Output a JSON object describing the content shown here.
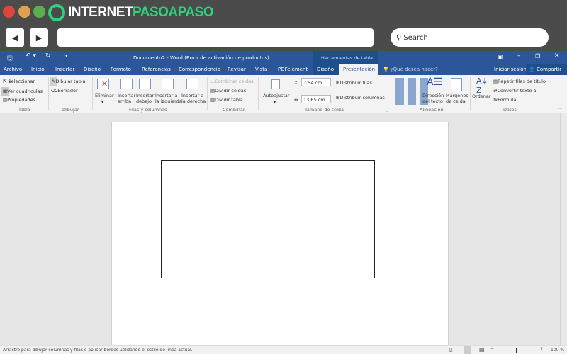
{
  "browser": {
    "brand_white": "INTERNET",
    "brand_green": "PASOAPASO",
    "search_placeholder": "Search",
    "brand_color": "#2fd17a"
  },
  "word": {
    "title": "Documento2 - Word (Error de activación de productos)",
    "context_tab": "Herramientas de tabla",
    "tabs": [
      "Archivo",
      "Inicio",
      "Insertar",
      "Diseño",
      "Formato",
      "Referencias",
      "Correspondencia",
      "Revisar",
      "Vista",
      "PDFelement",
      "Diseño",
      "Presentación"
    ],
    "tell_me": "¿Qué desea hacer?",
    "sign_in": "Iniciar sesión",
    "share": "Compartir"
  },
  "ribbon": {
    "tabla": {
      "items": [
        "Seleccionar",
        "Ver cuadrículas",
        "Propiedades"
      ],
      "group": "Tabla"
    },
    "dibujar": {
      "items": [
        "Dibujar tabla",
        "Borrador"
      ],
      "group": "Dibujar"
    },
    "filas": {
      "eliminar": "Eliminar",
      "ins_arriba": [
        "Insertar",
        "arriba"
      ],
      "ins_debajo": [
        "Insertar",
        "debajo"
      ],
      "ins_izq": [
        "Insertar a",
        "la izquierda"
      ],
      "ins_der": [
        "Insertar a",
        "la derecha"
      ],
      "group": "Filas y columnas"
    },
    "combinar": {
      "items": [
        "Combinar celdas",
        "Dividir celdas",
        "Dividir tabla"
      ],
      "group": "Combinar"
    },
    "tamano": {
      "autoajustar": "Autoajustar",
      "height": "7,54 cm",
      "width": "13,65 cm",
      "dist_filas": "Distribuir filas",
      "dist_cols": "Distribuir columnas",
      "group": "Tamaño de celda"
    },
    "alineacion": {
      "direccion": [
        "Dirección",
        "del texto"
      ],
      "margenes": [
        "Márgenes",
        "de celda"
      ],
      "group": "Alineación"
    },
    "datos": {
      "ordenar": "Ordenar",
      "items": [
        "Repetir filas de título",
        "Convertir texto a",
        "Fórmula"
      ],
      "group": "Datos"
    }
  },
  "status": {
    "message": "Arrastre para dibujar columnas y filas o aplicar bordes utilizando el estilo de línea actual.",
    "zoom": "100 %"
  }
}
